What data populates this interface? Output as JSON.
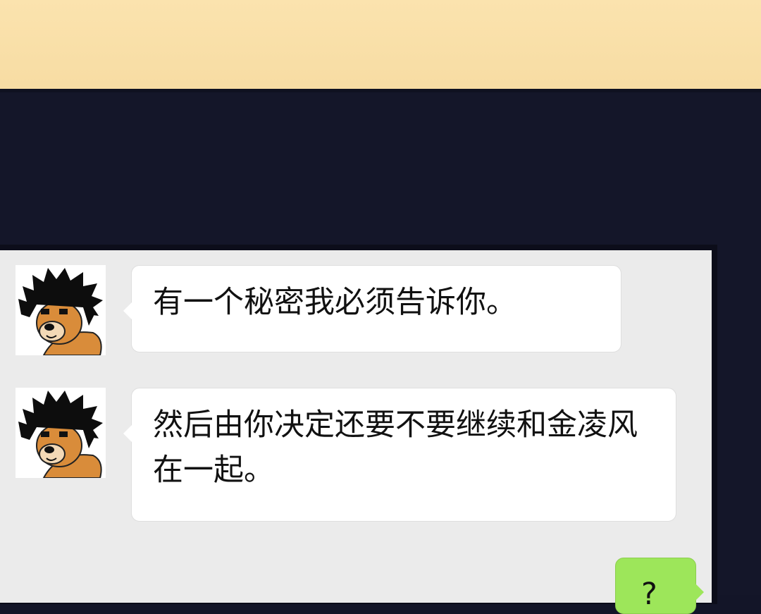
{
  "colors": {
    "top_panel": "#f7dca3",
    "background": "#141629",
    "chat_bg": "#ebebeb",
    "incoming_bubble": "#ffffff",
    "outgoing_bubble": "#9de65a"
  },
  "messages": [
    {
      "sender": "incoming",
      "avatar_icon": "shiba-dog-avatar-icon",
      "text": "有一个秘密我必须告诉你。"
    },
    {
      "sender": "incoming",
      "avatar_icon": "shiba-dog-avatar-icon",
      "text": "然后由你决定还要不要继续和金凌风在一起。"
    },
    {
      "sender": "outgoing",
      "text": "?"
    }
  ]
}
